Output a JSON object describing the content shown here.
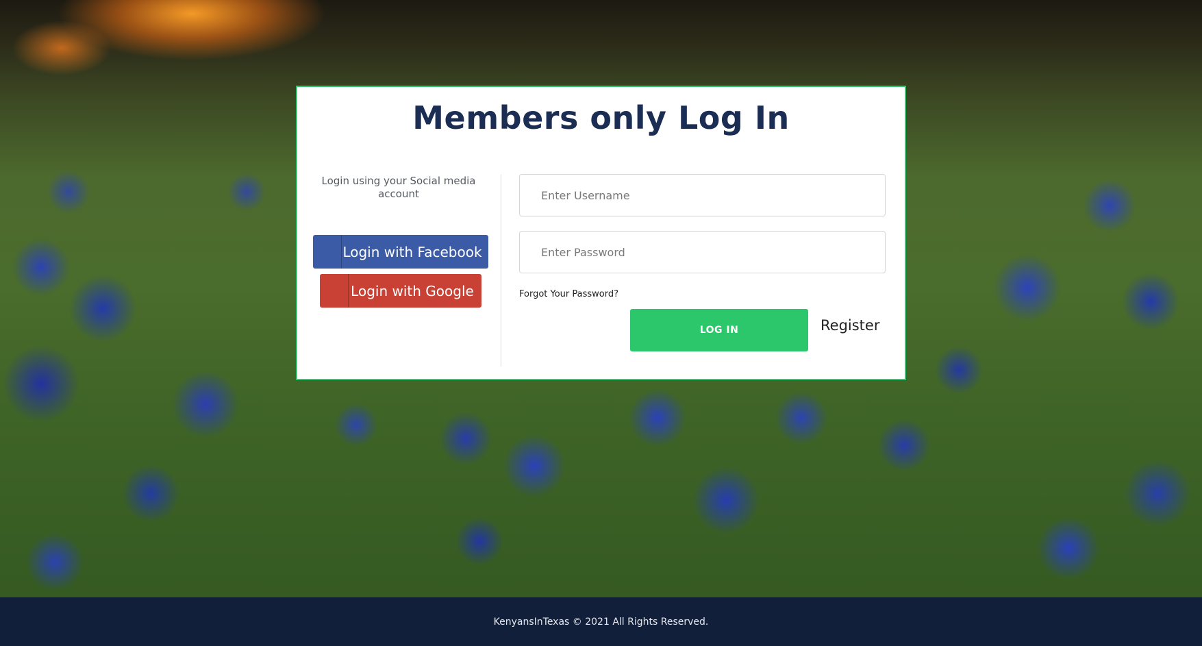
{
  "login": {
    "title": "Members only Log In",
    "social_caption": "Login using your Social media account",
    "facebook_label": "Login with Facebook",
    "google_label": "Login with Google",
    "username_placeholder": "Enter Username",
    "password_placeholder": "Enter Password",
    "forgot_label": "Forgot Your Password?",
    "login_button_label": "LOG IN",
    "register_label": "Register"
  },
  "footer": {
    "copyright": "KenyansInTexas © 2021 All Rights Reserved."
  },
  "icons": {
    "facebook": "facebook-icon",
    "google": "google-icon"
  },
  "colors": {
    "title": "#1c2d54",
    "card_border": "#2fc66c",
    "facebook": "#3b5ba6",
    "google": "#c84134",
    "login_button": "#2bc76a",
    "footer_bg": "#111f3b"
  }
}
